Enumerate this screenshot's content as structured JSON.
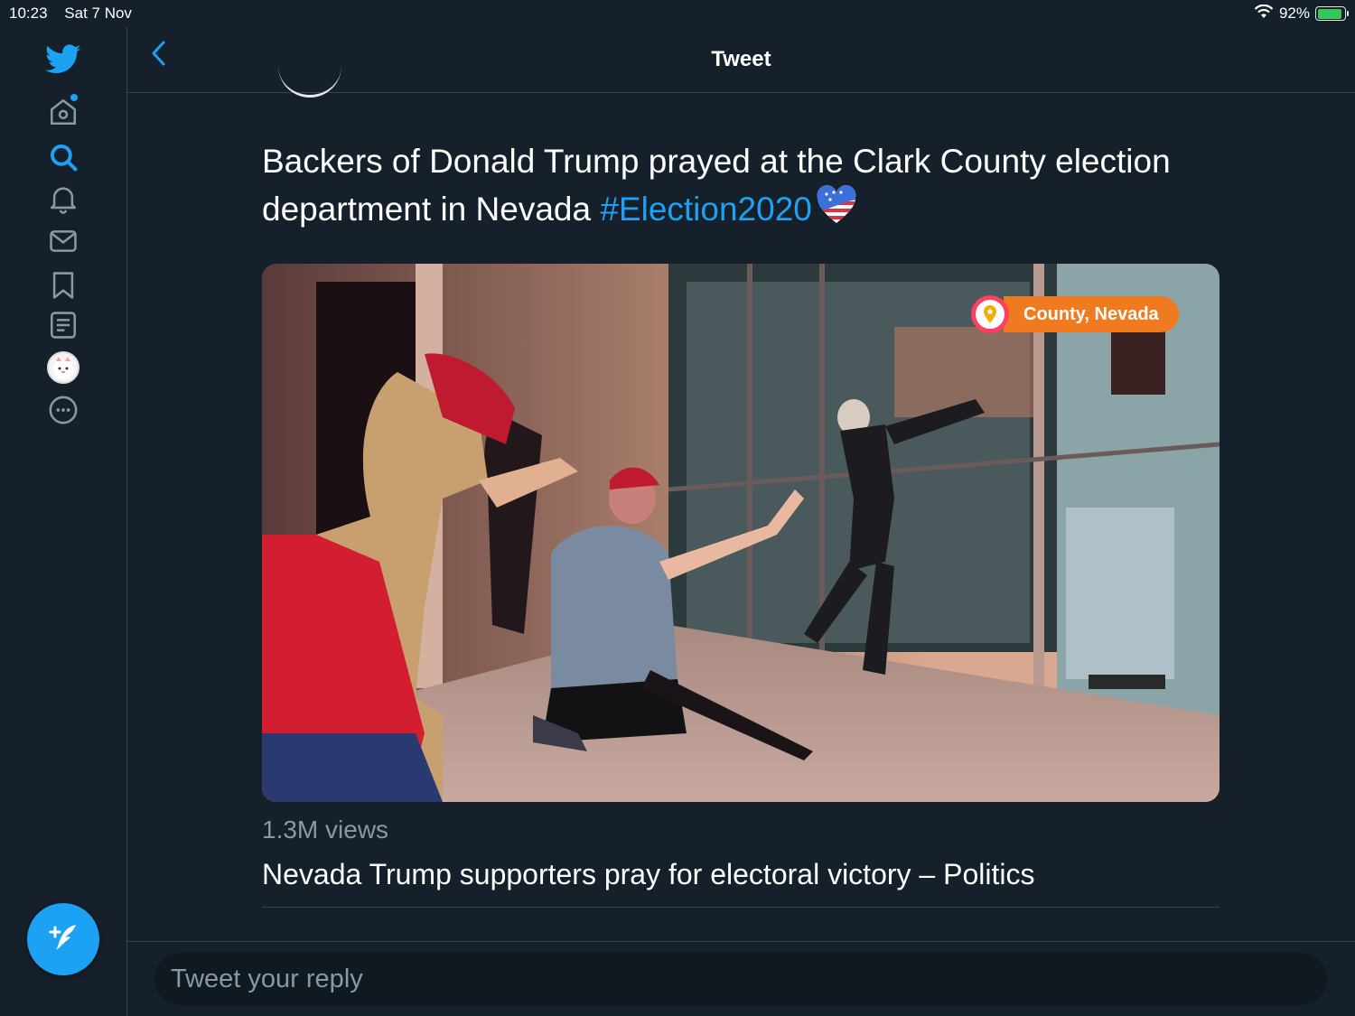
{
  "status_bar": {
    "time": "10:23",
    "date": "Sat 7 Nov",
    "battery": "92%",
    "battery_level": 0.92
  },
  "sidebar": {
    "items": [
      {
        "icon": "twitter-bird-icon"
      },
      {
        "icon": "home-icon",
        "has_notification_dot": true
      },
      {
        "icon": "search-icon",
        "active": true
      },
      {
        "icon": "bell-icon"
      },
      {
        "icon": "mail-icon"
      },
      {
        "icon": "bookmark-icon"
      },
      {
        "icon": "list-icon"
      },
      {
        "icon": "profile-avatar"
      },
      {
        "icon": "more-icon"
      }
    ],
    "compose_icon": "compose-tweet-icon"
  },
  "header": {
    "title": "Tweet",
    "back_icon": "chevron-left-icon"
  },
  "tweet": {
    "text": "Backers of Donald Trump prayed at the Clark County election department in Nevada ",
    "hashtag": "#Election2020",
    "media": {
      "location_label": "County, Nevada"
    },
    "views": "1.3M views",
    "source_title": "Nevada Trump supporters pray for electoral victory – Politics"
  },
  "reply": {
    "placeholder": "Tweet your reply"
  },
  "colors": {
    "background": "#15202b",
    "accent": "#1da1f2",
    "muted_text": "#8899a6",
    "border": "#38444d"
  }
}
